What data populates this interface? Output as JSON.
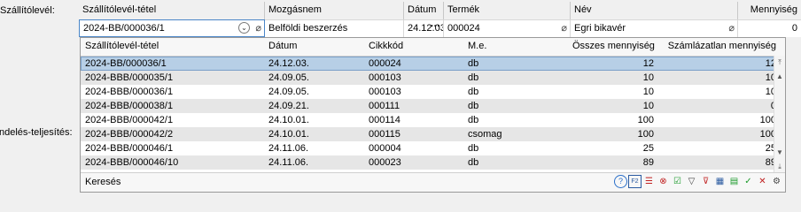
{
  "labels": {
    "delivery_note": "Szállítólevél:",
    "order_fulfillment": "ndelés-teljesítés:"
  },
  "header_columns": [
    "Szállítólevél-tétel",
    "Mozgásnem",
    "Dátum",
    "Termék",
    "Név",
    "Mennyiség"
  ],
  "values": {
    "item": "2024-BB/000036/1",
    "movement": "Belföldi beszerzés",
    "date": "24.12.03.",
    "product": "000024",
    "name": "Egri bikavér",
    "quantity": "0"
  },
  "dropdown": {
    "columns": [
      "Szállítólevél-tétel",
      "Dátum",
      "Cikkkód",
      "M.e.",
      "Összes mennyiség",
      "Számlázatlan mennyiség"
    ],
    "rows": [
      [
        "2024-BB/000036/1",
        "24.12.03.",
        "000024",
        "db",
        "12",
        "12"
      ],
      [
        "2024-BBB/000035/1",
        "24.09.05.",
        "000103",
        "db",
        "10",
        "10"
      ],
      [
        "2024-BBB/000036/1",
        "24.09.05.",
        "000103",
        "db",
        "10",
        "10"
      ],
      [
        "2024-BBB/000038/1",
        "24.09.21.",
        "000111",
        "db",
        "10",
        "0"
      ],
      [
        "2024-BBB/000042/1",
        "24.10.01.",
        "000114",
        "db",
        "100",
        "100"
      ],
      [
        "2024-BBB/000042/2",
        "24.10.01.",
        "000115",
        "csomag",
        "100",
        "100"
      ],
      [
        "2024-BBB/000046/1",
        "24.11.06.",
        "000004",
        "db",
        "25",
        "25"
      ],
      [
        "2024-BBB/000046/10",
        "24.11.06.",
        "000023",
        "db",
        "89",
        "89"
      ]
    ],
    "search_label": "Keresés",
    "tools": [
      "help-icon",
      "f2-icon",
      "filter-list-icon",
      "remove-filter-icon",
      "checklist-icon",
      "funnel-icon",
      "funnel-clear-icon",
      "columns-icon",
      "grid-icon",
      "confirm-icon",
      "cancel-icon",
      "settings-icon"
    ]
  }
}
